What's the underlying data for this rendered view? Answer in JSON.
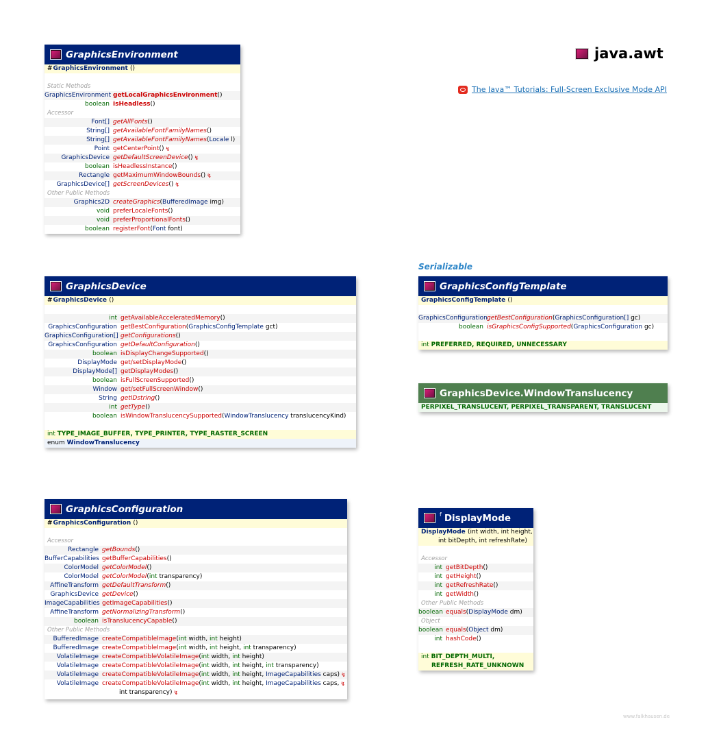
{
  "package": {
    "name": "java.awt"
  },
  "tutorial": {
    "text": "The Java™ Tutorials: Full-Screen Exclusive Mode API"
  },
  "footer": "www.falkhausen.de",
  "stereotype": "Serializable",
  "ge": {
    "title": "GraphicsEnvironment",
    "ctor": "GraphicsEnvironment",
    "ctor_args": "()",
    "sec_static": "Static Methods",
    "sec_accessor": "Accessor",
    "sec_other": "Other Public Methods",
    "static": [
      {
        "ret": "GraphicsEnvironment",
        "name": "getLocalGraphicsEnvironment",
        "args": "()"
      },
      {
        "ret": "boolean",
        "name": "isHeadless",
        "args": "()"
      }
    ],
    "accessor": [
      {
        "ret": "Font[]",
        "name": "getAllFonts",
        "args": "()"
      },
      {
        "ret": "String[]",
        "name": "getAvailableFontFamilyNames",
        "args": "()"
      },
      {
        "ret": "String[]",
        "name": "getAvailableFontFamilyNames",
        "args": "(Locale l)"
      },
      {
        "ret": "Point",
        "name": "getCenterPoint",
        "args": "()"
      },
      {
        "ret": "GraphicsDevice",
        "name": "getDefaultScreenDevice",
        "args": "()"
      },
      {
        "ret": "boolean",
        "name": "isHeadlessInstance",
        "args": "()"
      },
      {
        "ret": "Rectangle",
        "name": "getMaximumWindowBounds",
        "args": "()"
      },
      {
        "ret": "GraphicsDevice[]",
        "name": "getScreenDevices",
        "args": "()"
      }
    ],
    "other": [
      {
        "ret": "Graphics2D",
        "name": "createGraphics",
        "args": "(BufferedImage img)"
      },
      {
        "ret": "void",
        "name": "preferLocaleFonts",
        "args": "()"
      },
      {
        "ret": "void",
        "name": "preferProportionalFonts",
        "args": "()"
      },
      {
        "ret": "boolean",
        "name": "registerFont",
        "args": "(Font font)"
      }
    ]
  },
  "gd": {
    "title": "GraphicsDevice",
    "ctor": "GraphicsDevice",
    "ctor_args": "()",
    "methods": [
      {
        "ret": "int",
        "name": "getAvailableAcceleratedMemory",
        "args": "()"
      },
      {
        "ret": "GraphicsConfiguration",
        "name": "getBestConfiguration",
        "args": "(GraphicsConfigTemplate gct)"
      },
      {
        "ret": "GraphicsConfiguration[]",
        "name": "getConfigurations",
        "args": "()"
      },
      {
        "ret": "GraphicsConfiguration",
        "name": "getDefaultConfiguration",
        "args": "()"
      },
      {
        "ret": "boolean",
        "name": "isDisplayChangeSupported",
        "args": "()"
      },
      {
        "ret": "DisplayMode",
        "name": "get/setDisplayMode",
        "args": "()"
      },
      {
        "ret": "DisplayMode[]",
        "name": "getDisplayModes",
        "args": "()"
      },
      {
        "ret": "boolean",
        "name": "isFullScreenSupported",
        "args": "()"
      },
      {
        "ret": "Window",
        "name": "get/setFullScreenWindow",
        "args": "()"
      },
      {
        "ret": "String",
        "name": "getIDstring",
        "args": "()"
      },
      {
        "ret": "int",
        "name": "getType",
        "args": "()"
      },
      {
        "ret": "boolean",
        "name": "isWindowTranslucencySupported",
        "args": "(WindowTranslucency translucencyKind)"
      }
    ],
    "fields_type": "int",
    "fields": "TYPE_IMAGE_BUFFER, TYPE_PRINTER, TYPE_RASTER_SCREEN",
    "enum_kw": "enum",
    "enum_name": "WindowTranslucency"
  },
  "gc": {
    "title": "GraphicsConfiguration",
    "ctor": "GraphicsConfiguration",
    "ctor_args": "()",
    "sec_accessor": "Accessor",
    "sec_other": "Other Public Methods",
    "accessor": [
      {
        "ret": "Rectangle",
        "name": "getBounds",
        "args": "()"
      },
      {
        "ret": "BufferCapabilities",
        "name": "getBufferCapabilities",
        "args": "()"
      },
      {
        "ret": "ColorModel",
        "name": "getColorModel",
        "args": "()"
      },
      {
        "ret": "ColorModel",
        "name": "getColorModel",
        "args": "(int transparency)"
      },
      {
        "ret": "AffineTransform",
        "name": "getDefaultTransform",
        "args": "()"
      },
      {
        "ret": "GraphicsDevice",
        "name": "getDevice",
        "args": "()"
      },
      {
        "ret": "ImageCapabilities",
        "name": "getImageCapabilities",
        "args": "()"
      },
      {
        "ret": "AffineTransform",
        "name": "getNormalizingTransform",
        "args": "()"
      },
      {
        "ret": "boolean",
        "name": "isTranslucencyCapable",
        "args": "()"
      }
    ],
    "other": [
      {
        "ret": "BufferedImage",
        "name": "createCompatibleImage",
        "args": "(int width, int height)"
      },
      {
        "ret": "BufferedImage",
        "name": "createCompatibleImage",
        "args": "(int width, int height, int transparency)"
      },
      {
        "ret": "VolatileImage",
        "name": "createCompatibleVolatileImage",
        "args": "(int width, int height)"
      },
      {
        "ret": "VolatileImage",
        "name": "createCompatibleVolatileImage",
        "args": "(int width, int height, int transparency)"
      },
      {
        "ret": "VolatileImage",
        "name": "createCompatibleVolatileImage",
        "args": "(int width, int height, ImageCapabilities caps)"
      },
      {
        "ret": "VolatileImage",
        "name": "createCompatibleVolatileImage",
        "args": "(int width, int height, ImageCapabilities caps,"
      }
    ],
    "cont": "int transparency)"
  },
  "gct": {
    "title": "GraphicsConfigTemplate",
    "ctor": "GraphicsConfigTemplate",
    "ctor_args": "()",
    "methods": [
      {
        "ret": "GraphicsConfiguration",
        "name": "getBestConfiguration",
        "args": "(GraphicsConfiguration[] gc)"
      },
      {
        "ret": "boolean",
        "name": "isGraphicsConfigSupported",
        "args": "(GraphicsConfiguration gc)"
      }
    ],
    "fields_type": "int",
    "fields": "PREFERRED, REQUIRED, UNNECESSARY"
  },
  "wt": {
    "title": "GraphicsDevice.WindowTranslucency",
    "fields": "PERPIXEL_TRANSLUCENT, PERPIXEL_TRANSPARENT, TRANSLUCENT"
  },
  "dm": {
    "title": "DisplayMode",
    "final_mark": "f",
    "ctor": "DisplayMode",
    "ctor_args": "(int width, int height,",
    "ctor_args2": "int bitDepth, int refreshRate)",
    "sec_accessor": "Accessor",
    "sec_other": "Other Public Methods",
    "sec_object": "Object",
    "accessor": [
      {
        "ret": "int",
        "name": "getBitDepth",
        "args": "()"
      },
      {
        "ret": "int",
        "name": "getHeight",
        "args": "()"
      },
      {
        "ret": "int",
        "name": "getRefreshRate",
        "args": "()"
      },
      {
        "ret": "int",
        "name": "getWidth",
        "args": "()"
      }
    ],
    "other": [
      {
        "ret": "boolean",
        "name": "equals",
        "args": "(DisplayMode dm)"
      }
    ],
    "object": [
      {
        "ret": "boolean",
        "name": "equals",
        "args": "(Object dm)"
      },
      {
        "ret": "int",
        "name": "hashCode",
        "args": "()"
      }
    ],
    "fields_type": "int",
    "fields": "BIT_DEPTH_MULTI,",
    "fields2": "REFRESH_RATE_UNKNOWN"
  }
}
